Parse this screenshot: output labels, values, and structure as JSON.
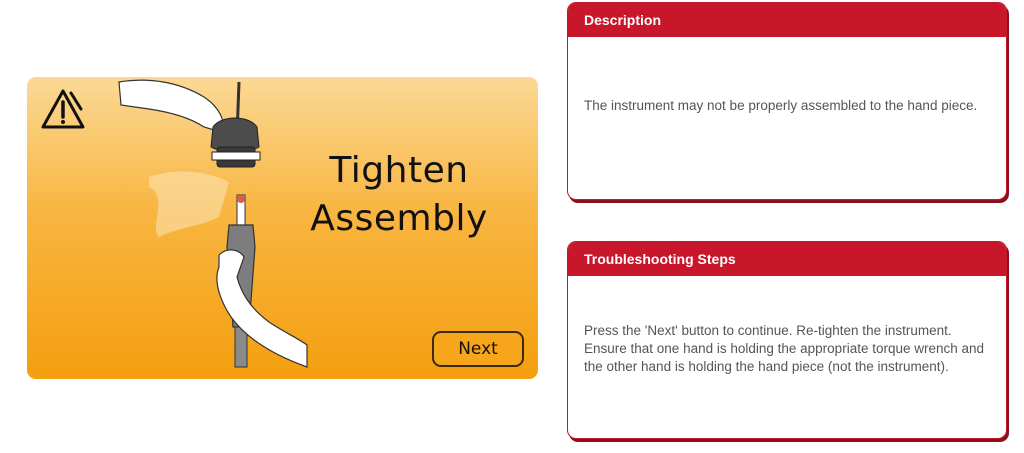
{
  "screen": {
    "title_line1": "Tighten",
    "title_line2": "Assembly",
    "next_label": "Next"
  },
  "description": {
    "heading": "Description",
    "text": "The instrument may not be properly assembled to the hand piece."
  },
  "troubleshooting": {
    "heading": "Troubleshooting Steps",
    "text": "Press the 'Next' button to continue. Re-tighten the instrument. Ensure that one hand is holding the appropriate torque wrench and the other hand is holding the hand piece (not the instrument)."
  },
  "colors": {
    "accent_red": "#c8162a",
    "screen_orange": "#f8b540"
  },
  "icons": [
    "warning-icon"
  ]
}
